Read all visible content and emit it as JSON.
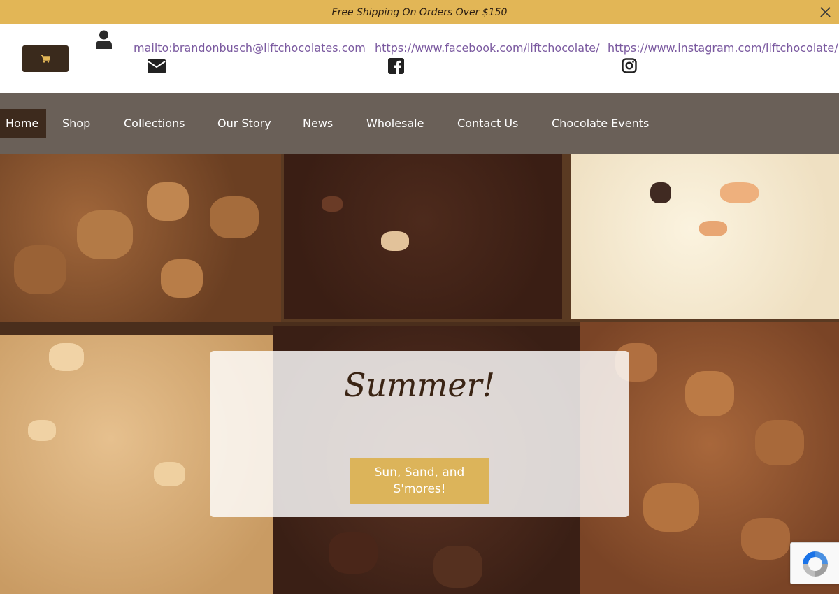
{
  "announcement": {
    "text": "Free Shipping On Orders Over $150",
    "close_icon": "close-icon",
    "background": "#e2b656"
  },
  "header": {
    "cart_icon": "cart-icon",
    "account_icon": "user-icon",
    "links": [
      {
        "text": "mailto:brandonbusch@liftchocolates.com",
        "icon": "envelope-icon"
      },
      {
        "text": "https://www.facebook.com/liftchocolate/",
        "icon": "facebook-icon"
      },
      {
        "text": "https://www.instagram.com/liftchocolate/",
        "icon": "instagram-icon"
      }
    ],
    "link_color": "#7b5aa0"
  },
  "nav": {
    "items": [
      {
        "label": "Home",
        "active": true
      },
      {
        "label": "Shop"
      },
      {
        "label": "Collections"
      },
      {
        "label": "Our Story"
      },
      {
        "label": "News"
      },
      {
        "label": "Wholesale"
      },
      {
        "label": "Contact Us"
      },
      {
        "label": "Chocolate Events"
      }
    ],
    "background": "#6a6058"
  },
  "hero": {
    "title": "Summer!",
    "button_label": "Sun, Sand, and S'mores!",
    "button_color": "#dcb45a"
  },
  "recaptcha": {
    "icon": "recaptcha-icon"
  }
}
